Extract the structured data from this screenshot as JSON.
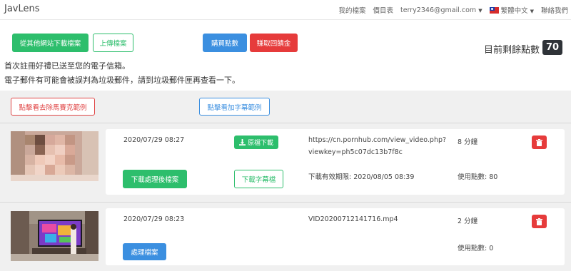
{
  "app": {
    "brand": "JavLens"
  },
  "nav": {
    "my_files": "我的檔案",
    "price_list": "價目表",
    "email": "terry2346@gmail.com",
    "language": "繁體中文",
    "contact": "聯絡我們"
  },
  "actions": {
    "download_from_site": "從其他網站下載檔案",
    "upload": "上傳檔案",
    "buy_points": "購買點數",
    "earn_rebate": "賺取回饋金"
  },
  "points": {
    "label": "目前剩餘點數",
    "value": "70"
  },
  "notice": {
    "line1": "首次註冊好禮已送至您的電子信箱。",
    "line2": "電子郵件有可能會被誤判為垃圾郵件，請到垃圾郵件匣再查看一下。"
  },
  "examples": {
    "mosaic_removal": "點擊看去除馬賽克範例",
    "subtitle": "點擊看加字幕範例"
  },
  "files": [
    {
      "date": "2020/07/29 08:27",
      "original_download": "原檔下載",
      "source_line1": "https://cn.pornhub.com/view_video.php?",
      "source_line2": "viewkey=ph5c07dc13b7f8c",
      "duration": "8 分鐘",
      "download_processed": "下載處理後檔案",
      "download_subtitle": "下載字幕檔",
      "expiry": "下載有效期限: 2020/08/05 08:39",
      "points_used": "使用點數: 80"
    },
    {
      "date": "2020/07/29 08:23",
      "source_line1": "VID20200712141716.mp4",
      "duration": "2 分鐘",
      "process": "處理檔案",
      "points_used": "使用點數: 0"
    }
  ],
  "colors": {
    "green": "#2dbe6c",
    "blue": "#3b8fe0",
    "red": "#e63b3b",
    "dark": "#2f3338"
  }
}
